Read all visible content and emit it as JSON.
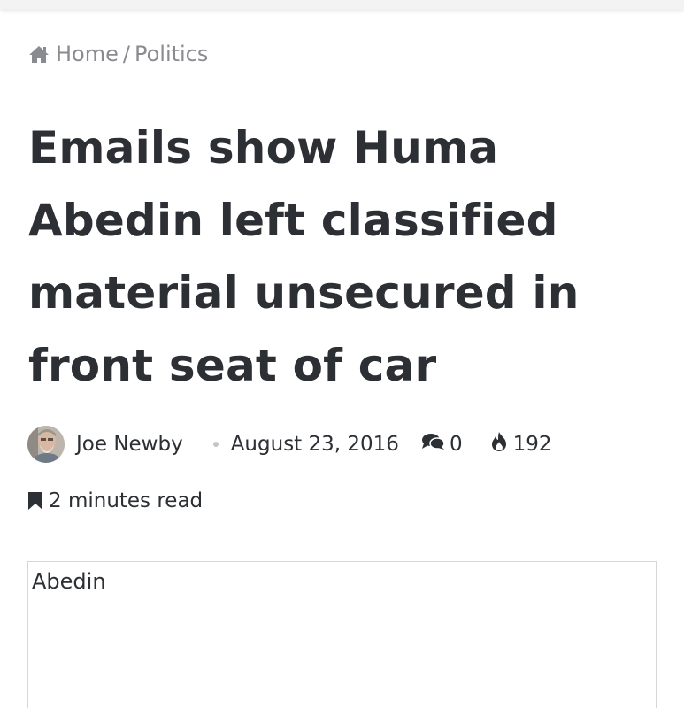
{
  "breadcrumb": {
    "home_label": "Home",
    "separator": "/",
    "category_label": "Politics"
  },
  "article": {
    "title": "Emails show Huma Abedin left classified material unsecured in front seat of car",
    "author": "Joe Newby",
    "date": "August 23, 2016",
    "comments_count": "0",
    "views_count": "192",
    "read_time": "2 minutes read",
    "image_alt": "Abedin"
  },
  "icons": {
    "breadcrumb_home": "home-icon",
    "comments": "comments-icon",
    "views": "fire-icon",
    "read_time": "bookmark-icon"
  },
  "colors": {
    "text": "#2c2f34",
    "muted": "#8a8b8e",
    "border": "#d6d6d8"
  }
}
